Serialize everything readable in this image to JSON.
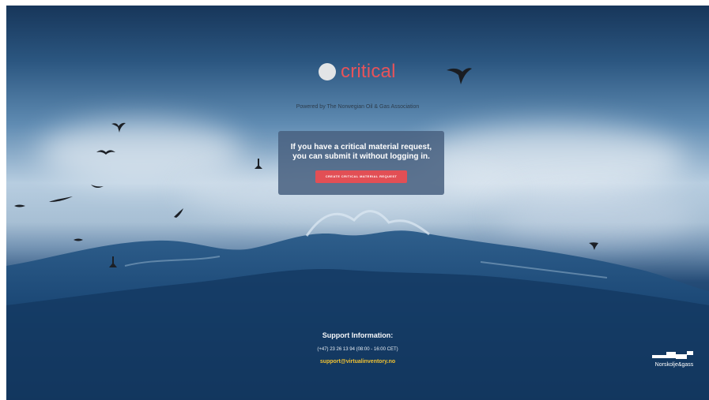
{
  "brand": {
    "name": "critical",
    "colors": {
      "brand": "#e7535a",
      "cta": "#e24f55",
      "link": "#f1c232"
    }
  },
  "powered_by": "Powered by The Norwegian Oil & Gas Association",
  "card": {
    "line1": "If you have a critical material request,",
    "line2": "you can submit it without logging in.",
    "button_label": "CREATE CRITICAL MATERIAL REQUEST"
  },
  "support": {
    "title": "Support Information:",
    "phone": "(+47) 23 26 13 94 (08:00 - 16:00 CET)",
    "email": "support@virtualinventory.no"
  },
  "partner_logo": {
    "text": "Norskolje&gass"
  },
  "icons": [
    "logo-circle-icon",
    "partner-logo-icon",
    "bird-icon"
  ]
}
